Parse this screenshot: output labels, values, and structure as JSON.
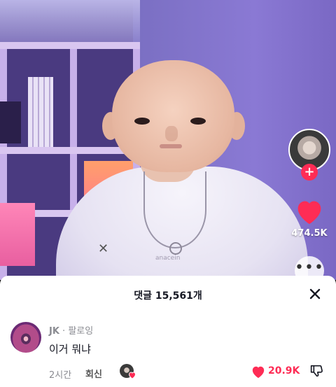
{
  "video": {
    "shirt_text": "anacein"
  },
  "rail": {
    "follow_symbol": "+",
    "like_count": "474.5K",
    "more_symbol": "•••"
  },
  "comments": {
    "title": "댓글 15,561개",
    "close_icon": "close-icon",
    "items": [
      {
        "author": "JK",
        "separator": " · ",
        "relation": "팔로잉",
        "text": "이거 뭐냐",
        "time": "2시간",
        "reply_label": "회신",
        "like_count": "20.9K",
        "liked": true
      }
    ]
  },
  "colors": {
    "accent": "#fe2c55",
    "sheet_bg": "#ffffff",
    "muted_text": "#8a8b91"
  }
}
